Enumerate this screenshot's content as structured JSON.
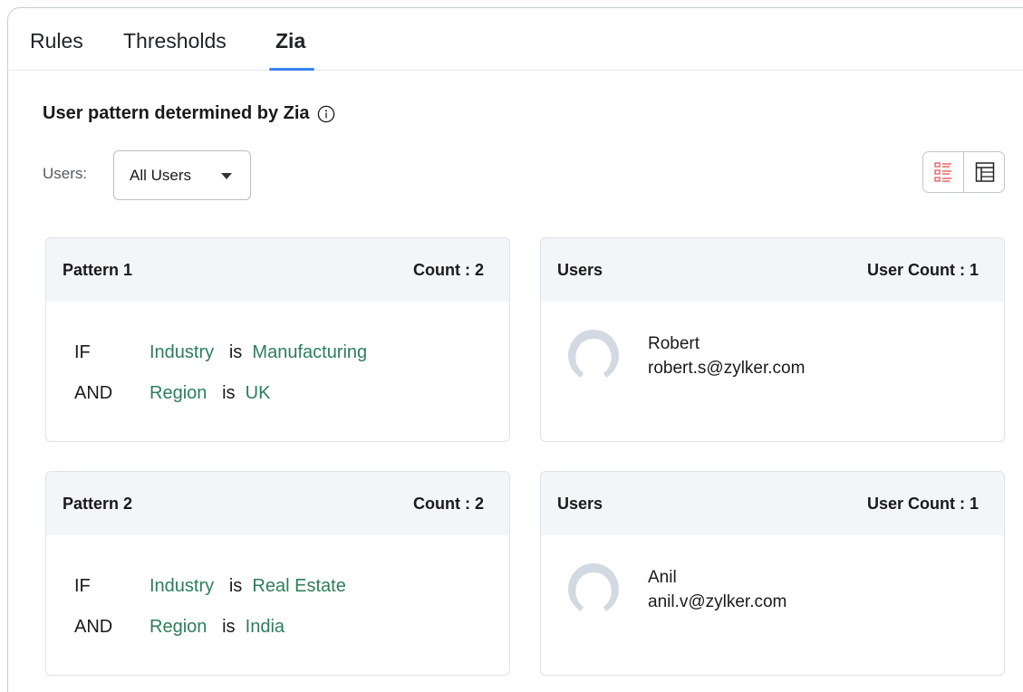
{
  "tabs": [
    {
      "label": "Rules",
      "active": false
    },
    {
      "label": "Thresholds",
      "active": false
    },
    {
      "label": "Zia",
      "active": true
    }
  ],
  "page": {
    "title": "User pattern determined by Zia",
    "info_icon": "info-circle-icon"
  },
  "filter": {
    "label": "Users:",
    "selected": "All Users"
  },
  "view_toggle": {
    "list_icon": "list-view-icon",
    "table_icon": "table-view-icon",
    "accent_color": "#e5484d"
  },
  "colors": {
    "accent": "#3b82f6",
    "value_green": "#2e7d5b",
    "header_bg": "#f3f5f9"
  },
  "patterns": [
    {
      "title": "Pattern 1",
      "count_label": "Count : 2",
      "conditions": [
        {
          "keyword": "IF",
          "field": "Industry",
          "operator": "is",
          "value": "Manufacturing"
        },
        {
          "keyword": "AND",
          "field": "Region",
          "operator": "is",
          "value": "UK"
        }
      ],
      "users_title": "Users",
      "user_count_label": "User Count : 1",
      "users": [
        {
          "name": "Robert",
          "email": "robert.s@zylker.com"
        }
      ]
    },
    {
      "title": "Pattern 2",
      "count_label": "Count : 2",
      "conditions": [
        {
          "keyword": "IF",
          "field": "Industry",
          "operator": "is",
          "value": "Real Estate"
        },
        {
          "keyword": "AND",
          "field": "Region",
          "operator": "is",
          "value": "India"
        }
      ],
      "users_title": "Users",
      "user_count_label": "User Count : 1",
      "users": [
        {
          "name": "Anil",
          "email": "anil.v@zylker.com"
        }
      ]
    }
  ]
}
